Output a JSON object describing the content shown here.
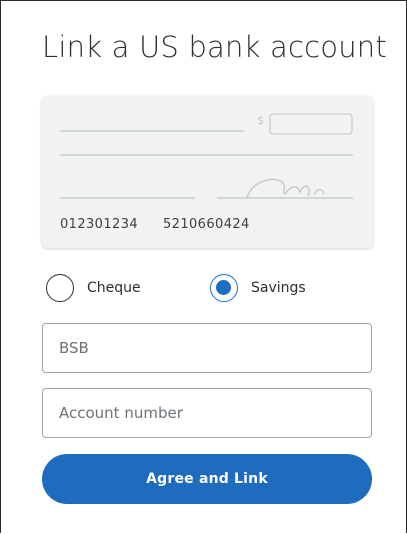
{
  "page": {
    "title": "Link a US bank account"
  },
  "cheque_illustration": {
    "dollar_sign": "$",
    "routing_number": "012301234",
    "account_number": "5210660424"
  },
  "account_type": {
    "options": [
      {
        "label": "Cheque",
        "selected": false
      },
      {
        "label": "Savings",
        "selected": true
      }
    ]
  },
  "form": {
    "bsb_placeholder": "BSB",
    "bsb_value": "",
    "account_placeholder": "Account number",
    "account_value": ""
  },
  "actions": {
    "submit_label": "Agree and Link"
  },
  "colors": {
    "accent": "#1e6cbd",
    "radio_selected": "#1d6fc4",
    "card_bg": "#f1f2f3",
    "text": "#2c2e2f"
  }
}
